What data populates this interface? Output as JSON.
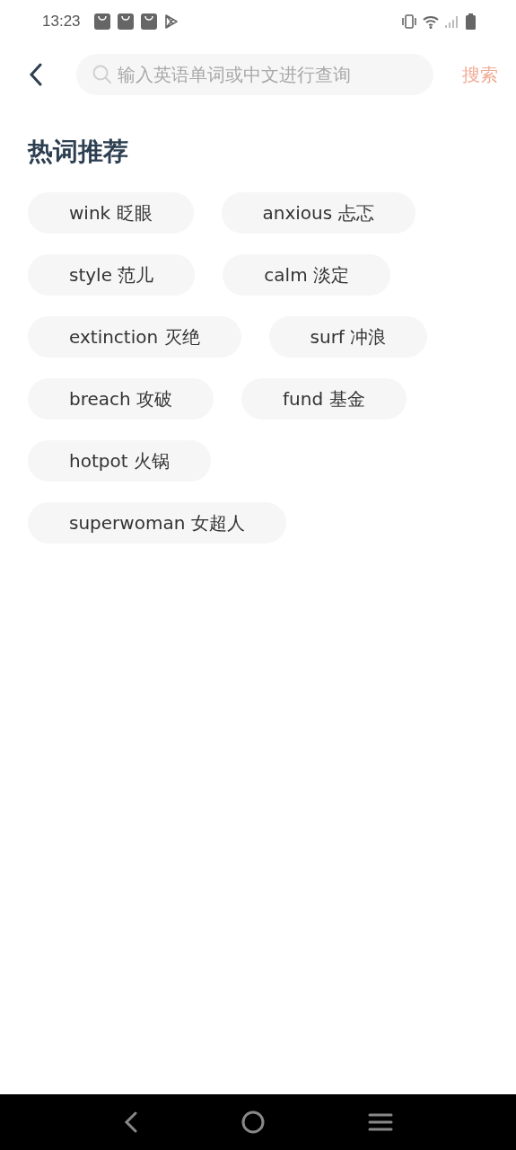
{
  "status_bar": {
    "time": "13:23"
  },
  "header": {
    "search": {
      "placeholder": "输入英语单词或中文进行查询"
    },
    "search_button": "搜索"
  },
  "hot_words": {
    "title": "热词推荐",
    "rows": [
      [
        "wink 眨眼",
        "anxious 忐忑"
      ],
      [
        "style 范儿",
        "calm 淡定"
      ],
      [
        "extinction 灭绝",
        "surf 冲浪"
      ],
      [
        "breach 攻破",
        "fund 基金"
      ],
      [
        "hotpot 火锅"
      ],
      [
        "superwoman 女超人"
      ]
    ]
  }
}
